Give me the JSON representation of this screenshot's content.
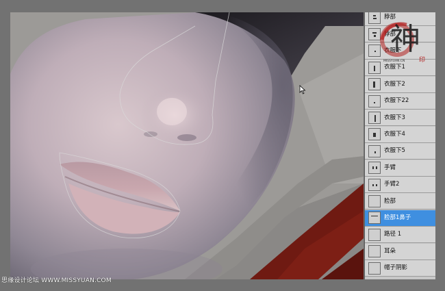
{
  "layers_panel": {
    "selected_index": 12,
    "items": [
      {
        "label": "脖部",
        "icon": "layer-thumbnail-icon"
      },
      {
        "label": "脖部",
        "icon": "layer-thumbnail-icon"
      },
      {
        "label": "衣服下",
        "icon": "layer-thumbnail-icon"
      },
      {
        "label": "衣服下1",
        "icon": "layer-thumbnail-icon"
      },
      {
        "label": "衣服下2",
        "icon": "layer-thumbnail-icon"
      },
      {
        "label": "衣服下22",
        "icon": "layer-thumbnail-icon"
      },
      {
        "label": "衣服下3",
        "icon": "layer-thumbnail-icon"
      },
      {
        "label": "衣服下4",
        "icon": "layer-thumbnail-icon"
      },
      {
        "label": "衣服下5",
        "icon": "layer-thumbnail-icon"
      },
      {
        "label": "手臂",
        "icon": "layer-thumbnail-icon"
      },
      {
        "label": "手臂2",
        "icon": "layer-thumbnail-icon"
      },
      {
        "label": "脸部",
        "icon": "layer-thumbnail-icon"
      },
      {
        "label": "脸部1鼻子",
        "icon": "layer-thumbnail-icon"
      },
      {
        "label": "路径 1",
        "icon": "layer-thumbnail-icon"
      },
      {
        "label": "耳朵",
        "icon": "layer-thumbnail-icon"
      },
      {
        "label": "帽子阴影",
        "icon": "layer-thumbnail-icon"
      }
    ]
  },
  "logo": {
    "glyph": "神",
    "site": "MISSYUAN.CN",
    "icon": "seal-logo-icon",
    "accent_color": "#b3201f"
  },
  "watermark": {
    "text": "思缘设计论坛 WWW.MISSYUAN.COM"
  },
  "cursor": {
    "icon": "arrow-cursor-icon"
  },
  "colors": {
    "selected_row": "#3f8fe0",
    "panel_bg": "#d4d4d4",
    "cloth_red": "#6f1a12"
  }
}
